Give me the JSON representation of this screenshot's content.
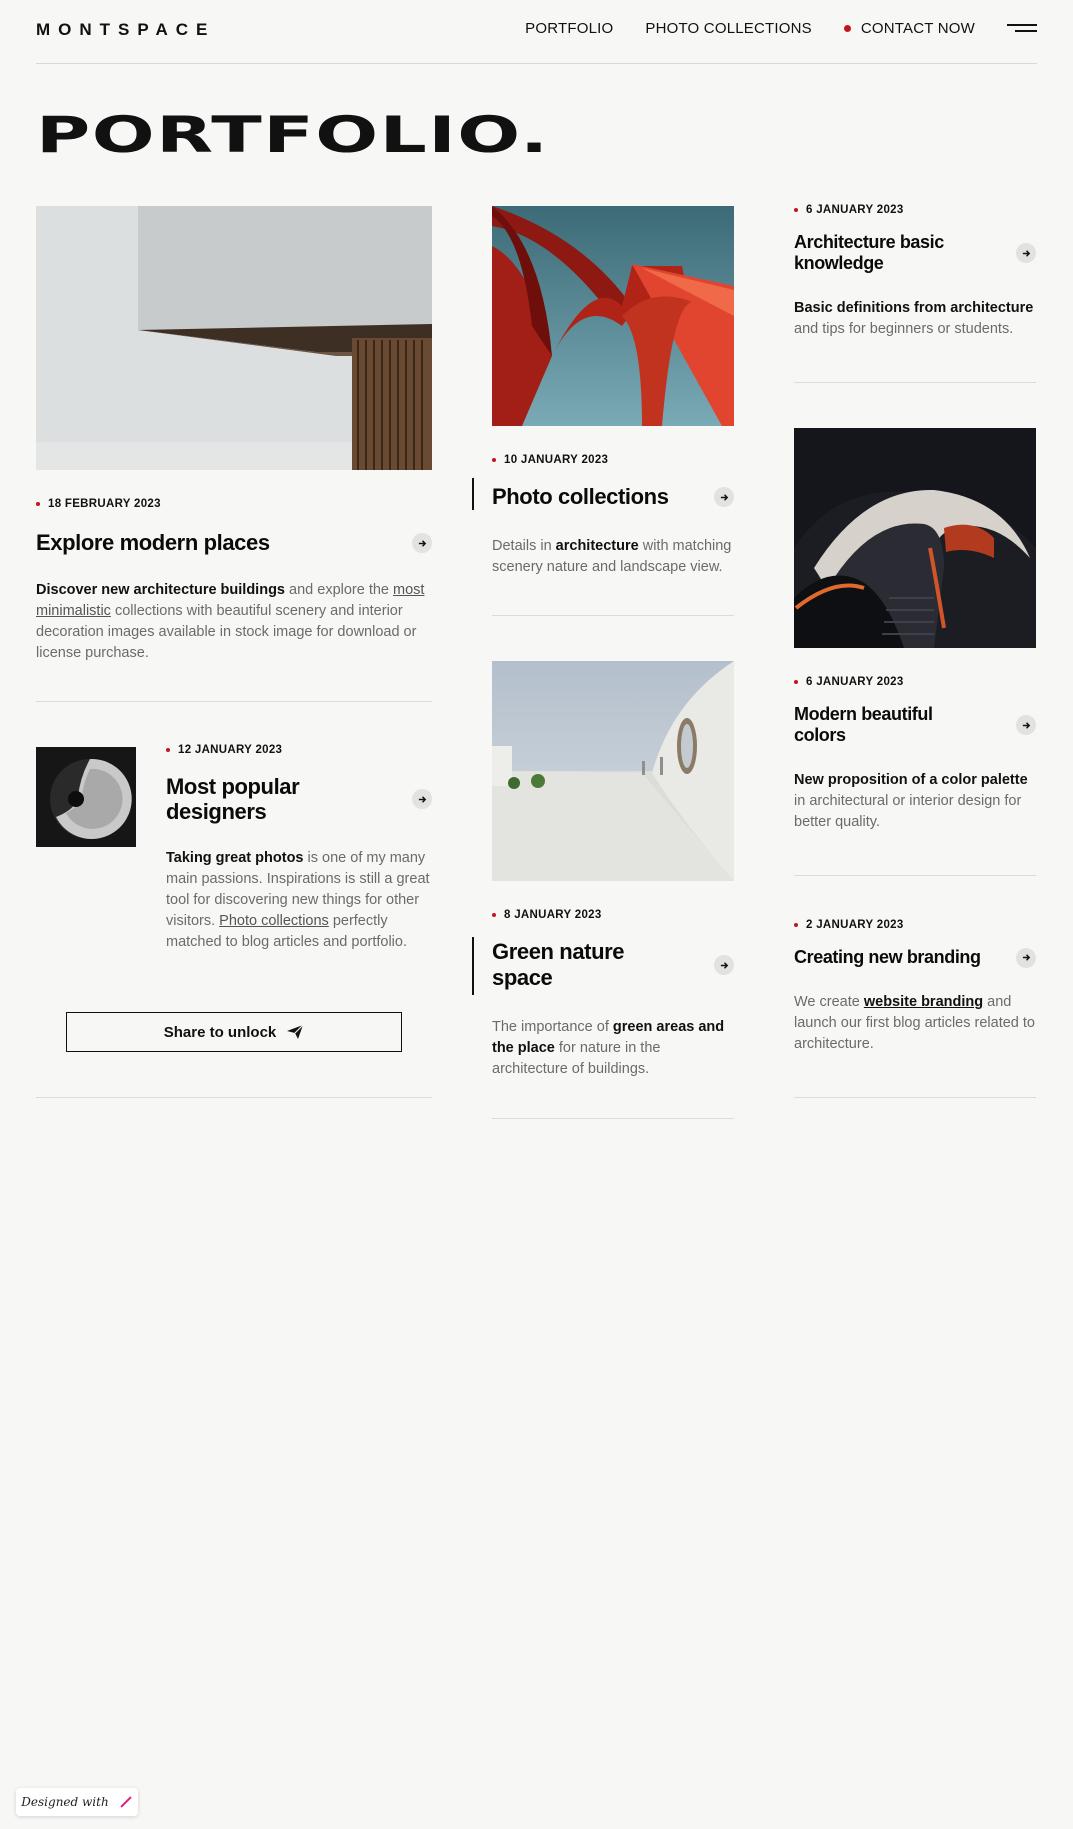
{
  "header": {
    "logo": "MONTSPACE",
    "nav": [
      "PORTFOLIO",
      "PHOTO COLLECTIONS",
      "CONTACT NOW"
    ]
  },
  "page_title": "PORTFOLIO.",
  "colors": {
    "accent": "#c0171d",
    "background": "#f7f7f5"
  },
  "cards": {
    "explore": {
      "date": "18 FEBRUARY 2023",
      "title": "Explore modern places",
      "desc_bold": "Discover new architecture buildings",
      "desc_a": " and explore the ",
      "desc_link": "most minimalistic",
      "desc_b": " collections with beautiful scenery and interior decoration images available in stock image for download or license purchase."
    },
    "designers": {
      "date": "12 JANUARY 2023",
      "title": "Most popular designers",
      "desc_bold": "Taking great photos",
      "desc_a": " is one of my many main passions. Inspirations is still a great tool for discovering new things for other visitors. ",
      "desc_link": "Photo collections",
      "desc_b": " perfectly matched to blog articles and portfolio.",
      "button": "Share to unlock"
    },
    "photo": {
      "date": "10 JANUARY 2023",
      "title": "Photo collections",
      "desc_a": "Details in ",
      "desc_bold": "architecture",
      "desc_b": " with matching scenery nature and landscape view."
    },
    "green": {
      "date": "8 JANUARY 2023",
      "title": "Green nature space",
      "desc_a": "The importance of ",
      "desc_bold": "green areas and the place",
      "desc_b": " for nature in the architecture of buildings."
    },
    "basic": {
      "date": "6 JANUARY 2023",
      "title": "Architecture basic knowledge",
      "desc_bold": "Basic definitions from architecture",
      "desc_b": " and tips for beginners or students."
    },
    "colors": {
      "date": "6 JANUARY 2023",
      "title": "Modern beautiful colors",
      "desc_bold": "New proposition of a color palette",
      "desc_b": " in architectural or interior design for better quality."
    },
    "branding": {
      "date": "2 JANUARY 2023",
      "title": "Creating new branding",
      "desc_a": "We create ",
      "desc_link": "website branding",
      "desc_b": " and launch our first blog articles related to architecture."
    }
  },
  "footer_badge": "Designed with"
}
